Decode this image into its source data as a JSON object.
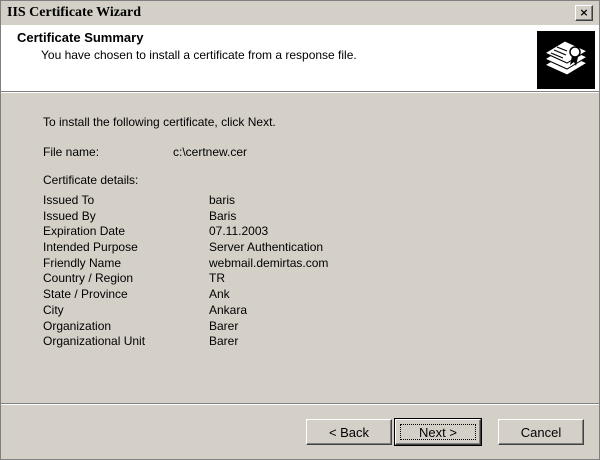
{
  "window": {
    "title": "IIS Certificate Wizard",
    "close_glyph": "×"
  },
  "header": {
    "title": "Certificate Summary",
    "subtitle": "You have chosen to install a certificate from a response file."
  },
  "content": {
    "intro": "To install the following certificate, click Next.",
    "file_label": "File name:",
    "file_value": "c:\\certnew.cer",
    "details_label": "Certificate details:",
    "details": [
      {
        "label": "Issued To",
        "value": "baris"
      },
      {
        "label": "Issued By",
        "value": "Baris"
      },
      {
        "label": "Expiration Date",
        "value": "07.11.2003"
      },
      {
        "label": "Intended Purpose",
        "value": "Server Authentication"
      },
      {
        "label": "Friendly Name",
        "value": "webmail.demirtas.com"
      },
      {
        "label": "Country / Region",
        "value": "TR"
      },
      {
        "label": "State / Province",
        "value": "Ank"
      },
      {
        "label": "City",
        "value": "Ankara"
      },
      {
        "label": "Organization",
        "value": "Barer"
      },
      {
        "label": "Organizational Unit",
        "value": "Barer"
      }
    ]
  },
  "buttons": {
    "back": "< Back",
    "next": "Next >",
    "cancel": "Cancel"
  },
  "colors": {
    "dialog_bg": "#d4d0c8",
    "header_bg": "#ffffff",
    "icon_bg": "#000000"
  },
  "icons": {
    "header": "certificate-icon"
  }
}
